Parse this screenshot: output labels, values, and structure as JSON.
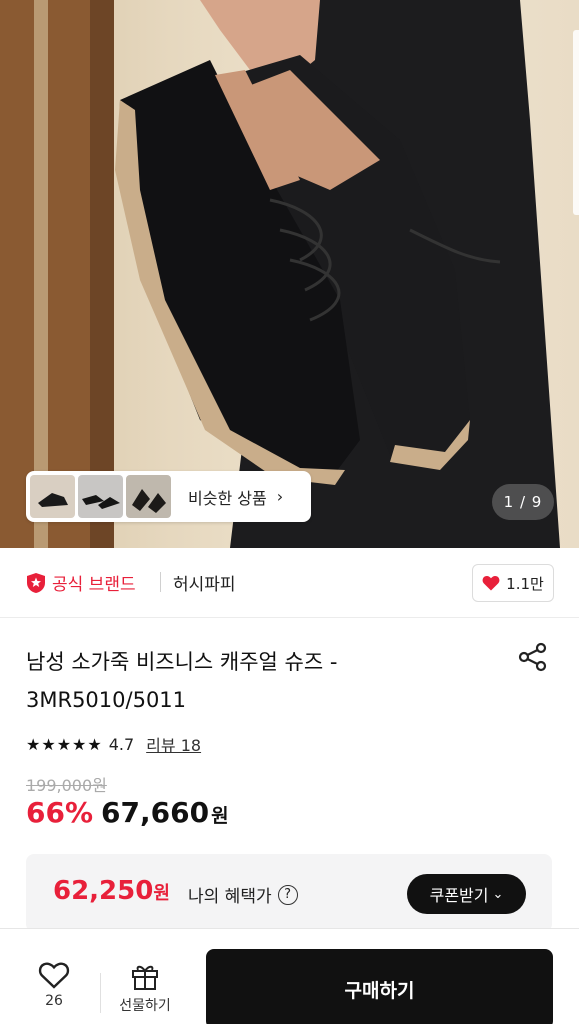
{
  "gallery": {
    "similar_label": "비슷한 상품",
    "page_counter": "1 / 9"
  },
  "brand": {
    "official_label": "공식 브랜드",
    "name": "허시파피",
    "likes": "1.1만"
  },
  "product": {
    "title_line1": "남성 소가죽 비즈니스 캐주얼 슈즈 -",
    "title_line2": "3MR5010/5011",
    "rating": "4.7",
    "review_label": "리뷰 18",
    "original_price": "199,000원",
    "discount": "66%",
    "price": "67,660",
    "currency": "원"
  },
  "benefit": {
    "price": "62,250",
    "currency": "원",
    "label": "나의 혜택가",
    "help": "?",
    "coupon_label": "쿠폰받기"
  },
  "bottom_bar": {
    "wish_count": "26",
    "gift_label": "선물하기",
    "buy_label": "구매하기"
  },
  "colors": {
    "accent": "#e8203a",
    "dark": "#111111"
  },
  "icons": {
    "official": "shield-star-icon",
    "like": "heart-icon",
    "share": "share-icon",
    "wish": "heart-outline-icon",
    "gift": "gift-icon",
    "chevron": "chevron-right-icon"
  }
}
